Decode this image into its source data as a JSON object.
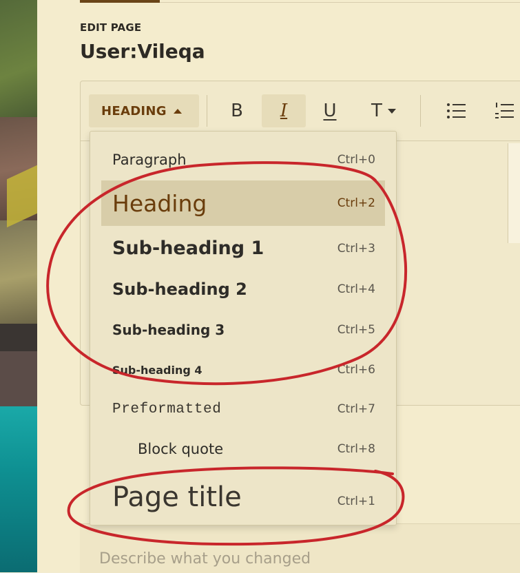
{
  "header": {
    "section_label": "EDIT PAGE",
    "page_name": "User:Vileqa"
  },
  "toolbar": {
    "format_label": "HEADING",
    "buttons": [
      {
        "label": "B",
        "icon": "bold-icon"
      },
      {
        "label": "I",
        "icon": "italic-icon"
      },
      {
        "label": "U",
        "icon": "underline-icon"
      },
      {
        "label": "T",
        "icon": "text-style-icon"
      },
      {
        "label": "",
        "icon": "bullet-list-icon"
      },
      {
        "label": "",
        "icon": "numbered-list-icon"
      }
    ]
  },
  "menu": {
    "items": [
      {
        "label": "Paragraph",
        "shortcut": "Ctrl+0"
      },
      {
        "label": "Heading",
        "shortcut": "Ctrl+2",
        "selected": true
      },
      {
        "label": "Sub-heading 1",
        "shortcut": "Ctrl+3"
      },
      {
        "label": "Sub-heading 2",
        "shortcut": "Ctrl+4"
      },
      {
        "label": "Sub-heading 3",
        "shortcut": "Ctrl+5"
      },
      {
        "label": "Sub-heading 4",
        "shortcut": "Ctrl+6"
      },
      {
        "label": "Preformatted",
        "shortcut": "Ctrl+7"
      },
      {
        "label": "Block quote",
        "shortcut": "Ctrl+8"
      },
      {
        "label": "Page title",
        "shortcut": "Ctrl+1"
      }
    ]
  },
  "summary": {
    "placeholder": "Describe what you changed"
  },
  "colors": {
    "accent": "#6a3d0c",
    "background": "#f4eccd",
    "annotation": "#c8262b"
  }
}
